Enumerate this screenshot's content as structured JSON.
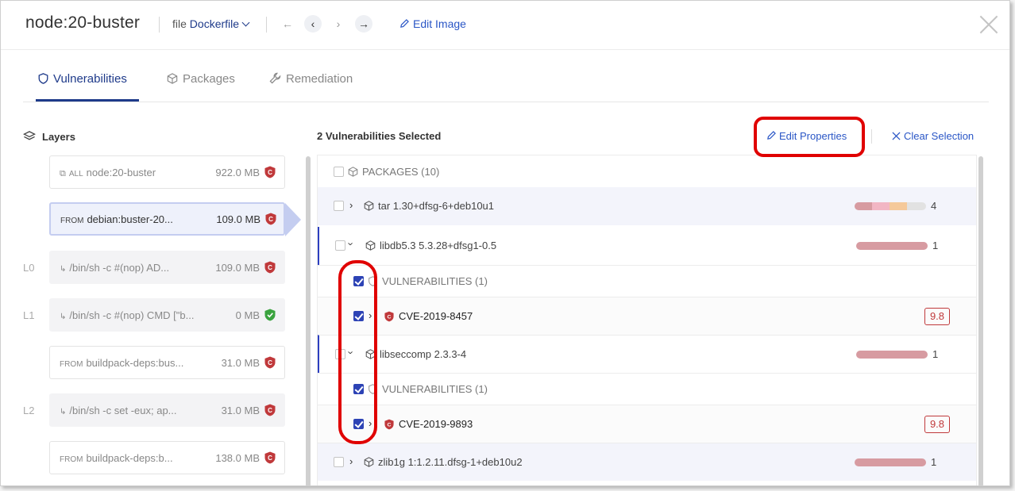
{
  "header": {
    "title": "node:20-buster",
    "file_prefix": "file",
    "file_name": "Dockerfile",
    "nav": [
      "←",
      "‹",
      "›",
      "→"
    ],
    "edit_image": "Edit Image"
  },
  "tabs": [
    {
      "label": "Vulnerabilities",
      "icon": "shield-icon",
      "active": true
    },
    {
      "label": "Packages",
      "icon": "package-icon",
      "active": false
    },
    {
      "label": "Remediation",
      "icon": "wrench-icon",
      "active": false
    }
  ],
  "layers": {
    "title": "Layers",
    "items": [
      {
        "tag": "ALL",
        "label": "node:20-buster",
        "size": "922.0 MB",
        "status": "critical",
        "num": ""
      },
      {
        "tag": "FROM",
        "label": "debian:buster-20...",
        "size": "109.0 MB",
        "status": "critical",
        "num": "",
        "selected": true
      },
      {
        "tag": "↳",
        "label": "/bin/sh -c #(nop) AD...",
        "size": "109.0 MB",
        "status": "critical",
        "num": "L0"
      },
      {
        "tag": "↳",
        "label": "/bin/sh -c #(nop) CMD [\"b...",
        "size": "0 MB",
        "status": "ok",
        "num": "L1"
      },
      {
        "tag": "FROM",
        "label": "buildpack-deps:bus...",
        "size": "31.0 MB",
        "status": "critical",
        "num": ""
      },
      {
        "tag": "↳",
        "label": "/bin/sh -c set -eux; ap...",
        "size": "31.0 MB",
        "status": "critical",
        "num": "L2"
      },
      {
        "tag": "FROM",
        "label": "buildpack-deps:b...",
        "size": "138.0 MB",
        "status": "critical",
        "num": ""
      }
    ]
  },
  "vulns": {
    "selected_count": "2 Vulnerabilities Selected",
    "edit_properties": "Edit Properties",
    "clear_selection": "Clear Selection",
    "packages_header": "PACKAGES (10)",
    "rows": [
      {
        "type": "pkg",
        "label": "tar 1.30+dfsg-6+deb10u1",
        "count": "4",
        "expanded": false
      },
      {
        "type": "pkg",
        "label": "libdb5.3 5.3.28+dfsg1-0.5",
        "count": "1",
        "expanded": true
      },
      {
        "type": "sub",
        "label": "VULNERABILITIES (1)"
      },
      {
        "type": "cve",
        "label": "CVE-2019-8457",
        "score": "9.8"
      },
      {
        "type": "pkg",
        "label": "libseccomp 2.3.3-4",
        "count": "1",
        "expanded": true
      },
      {
        "type": "sub",
        "label": "VULNERABILITIES (1)"
      },
      {
        "type": "cve",
        "label": "CVE-2019-9893",
        "score": "9.8"
      },
      {
        "type": "pkg",
        "label": "zlib1g 1:1.2.11.dfsg-1+deb10u2",
        "count": "1",
        "expanded": false
      }
    ]
  },
  "colors": {
    "accent": "#1e3a8a",
    "link": "#2a56c6",
    "critical": "#c0393b",
    "ok": "#3aa33f",
    "highlight": "#e00000"
  }
}
